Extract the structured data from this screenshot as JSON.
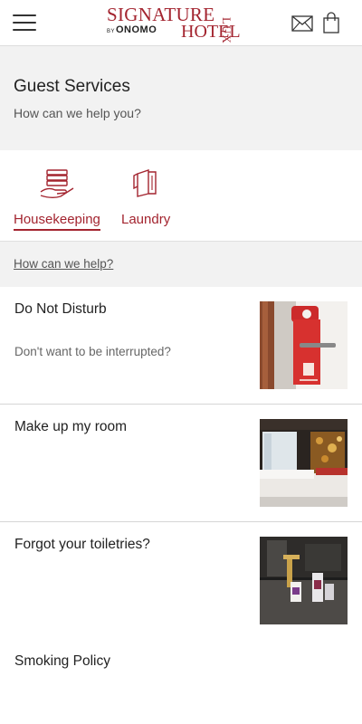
{
  "header": {
    "logo": {
      "signature": "SIGNATURE",
      "by": "BY",
      "brand": "ONOMO",
      "hotel": "HOTEL",
      "lux": "LUX"
    },
    "icons": {
      "menu": "hamburger-menu-icon",
      "mail": "envelope-icon",
      "bag": "shopping-bag-icon"
    }
  },
  "page": {
    "title": "Guest Services",
    "subtitle": "How can we help you?"
  },
  "categories": [
    {
      "label": "Housekeeping",
      "icon": "towels-hand-icon",
      "active": true
    },
    {
      "label": "Laundry",
      "icon": "laundry-folded-icon",
      "active": false
    }
  ],
  "help_link": "How can we help?",
  "services": [
    {
      "name": "Do Not Disturb",
      "description": "Don't want to be interrupted?",
      "image": "door-hanger-photo"
    },
    {
      "name": "Make up my room",
      "description": "",
      "image": "hotel-room-bed-photo"
    },
    {
      "name": "Forgot your toiletries?",
      "description": "",
      "image": "bathroom-toiletries-photo"
    },
    {
      "name": "Smoking Policy",
      "description": "",
      "image": ""
    }
  ],
  "colors": {
    "accent": "#a3242f",
    "panel_bg": "#f2f2f2",
    "divider": "#d6d6d6"
  }
}
